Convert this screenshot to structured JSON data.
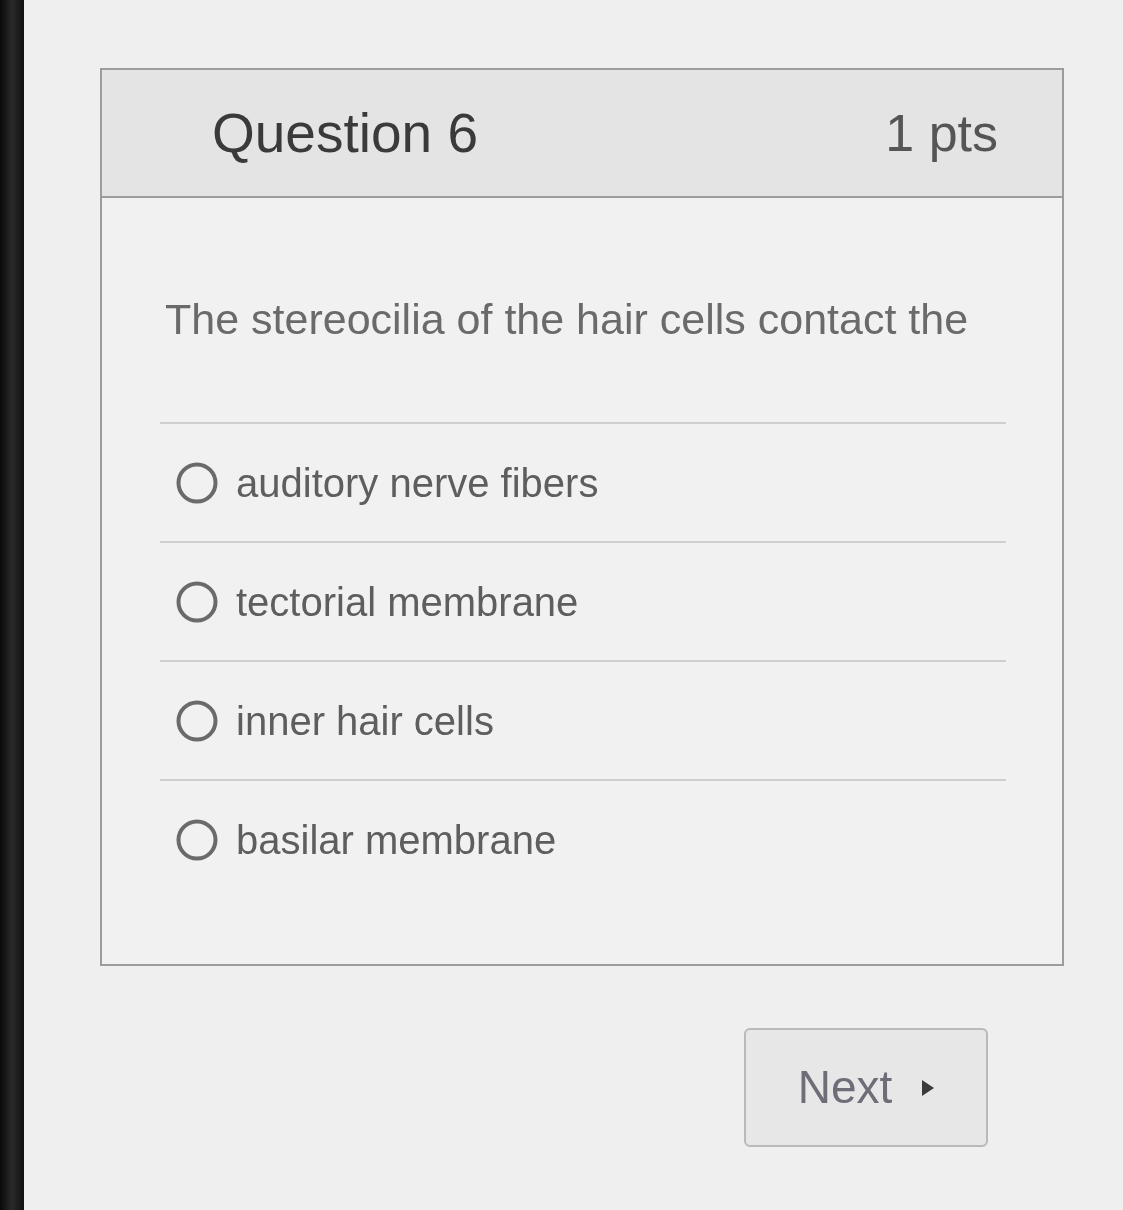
{
  "question": {
    "title": "Question 6",
    "points": "1 pts",
    "text": "The stereocilia of the hair cells contact the",
    "options": [
      {
        "label": "auditory nerve fibers",
        "selected": false
      },
      {
        "label": "tectorial membrane",
        "selected": false
      },
      {
        "label": "inner hair cells",
        "selected": false
      },
      {
        "label": "basilar membrane",
        "selected": false
      }
    ]
  },
  "next_button": {
    "label": "Next"
  }
}
